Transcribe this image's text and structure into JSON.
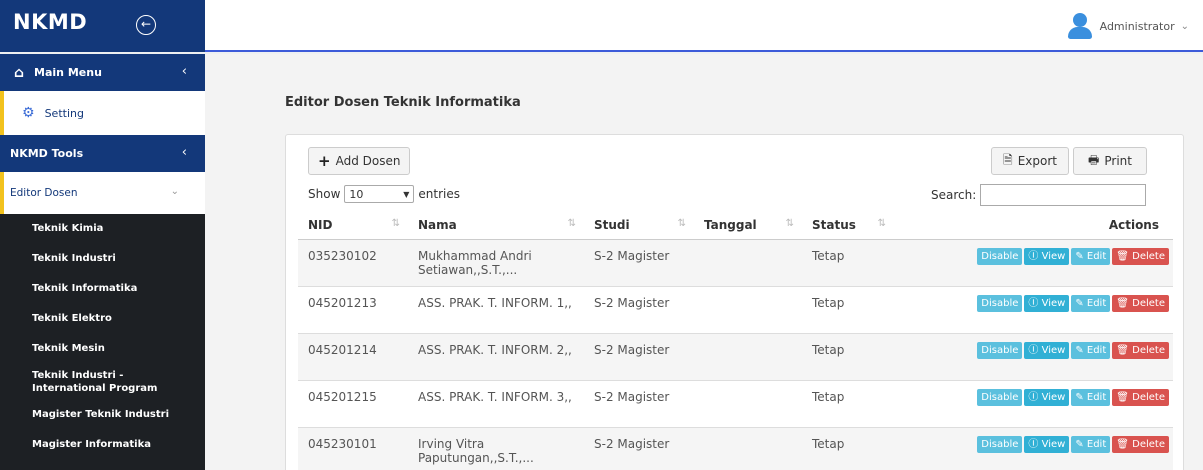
{
  "header": {
    "brand": "NKMD",
    "toggle_icon": "circle-arrow-left-icon",
    "user_name": "Administrator"
  },
  "sidebar": {
    "main_menu": "Main Menu",
    "setting": "Setting",
    "tools": "NKMD Tools",
    "editor": "Editor Dosen",
    "items": [
      "Teknik Kimia",
      "Teknik Industri",
      "Teknik Informatika",
      "Teknik Elektro",
      "Teknik Mesin",
      "Teknik Industri - International Program",
      "Magister Teknik Industri",
      "Magister Informatika"
    ]
  },
  "page": {
    "title": "Editor Dosen Teknik Informatika",
    "add_label": "Add Dosen",
    "export_label": "Export",
    "print_label": "Print",
    "show_label": "Show",
    "entries_value": "10",
    "entries_label": "entries",
    "search_label": "Search:",
    "search_value": ""
  },
  "table": {
    "headers": {
      "nid": "NID",
      "nama": "Nama",
      "studi": "Studi",
      "tanggal": "Tanggal",
      "status": "Status",
      "actions": "Actions"
    },
    "buttons": {
      "disable": "Disable",
      "view": "View",
      "edit": "Edit",
      "delete": "Delete"
    },
    "rows": [
      {
        "nid": "035230102",
        "nama": "Mukhammad Andri Setiawan,,S.T.,...",
        "studi": "S-2 Magister",
        "tanggal": "",
        "status": "Tetap"
      },
      {
        "nid": "045201213",
        "nama": "ASS. PRAK. T. INFORM. 1,,",
        "studi": "S-2 Magister",
        "tanggal": "",
        "status": "Tetap"
      },
      {
        "nid": "045201214",
        "nama": "ASS. PRAK. T. INFORM. 2,,",
        "studi": "S-2 Magister",
        "tanggal": "",
        "status": "Tetap"
      },
      {
        "nid": "045201215",
        "nama": "ASS. PRAK. T. INFORM. 3,,",
        "studi": "S-2 Magister",
        "tanggal": "",
        "status": "Tetap"
      },
      {
        "nid": "045230101",
        "nama": "Irving Vitra Paputungan,,S.T.,...",
        "studi": "S-2 Magister",
        "tanggal": "",
        "status": "Tetap"
      }
    ]
  },
  "colors": {
    "brand": "#13387a",
    "accent": "#f2c21d",
    "info": "#5bc0de",
    "danger": "#d9534f"
  }
}
